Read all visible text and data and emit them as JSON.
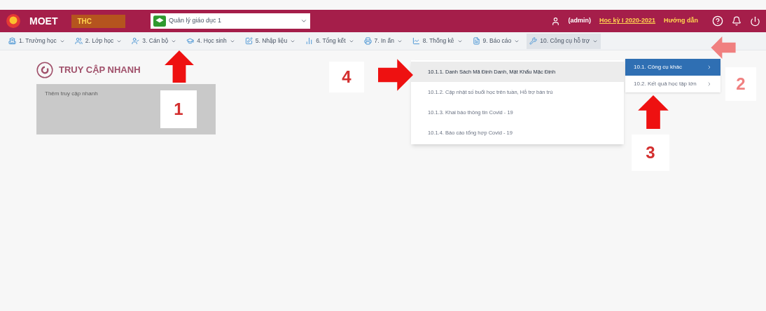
{
  "header": {
    "logo": "MOET",
    "school": "THC",
    "unit_select": "Quản lý giáo dục 1",
    "user": "(admin)",
    "term": "Học kỳ I 2020-2021",
    "help": "Hướng dẫn"
  },
  "nav": [
    {
      "label": "1. Trường học",
      "selected": false
    },
    {
      "label": "2. Lớp học",
      "selected": false
    },
    {
      "label": "3. Cán bộ",
      "selected": false
    },
    {
      "label": "4. Học sinh",
      "selected": false
    },
    {
      "label": "5. Nhập liệu",
      "selected": false
    },
    {
      "label": "6. Tổng kết",
      "selected": false
    },
    {
      "label": "7. In ấn",
      "selected": false
    },
    {
      "label": "8. Thống kê",
      "selected": false
    },
    {
      "label": "9. Báo cáo",
      "selected": false
    },
    {
      "label": "10. Công cụ hỗ trợ",
      "selected": true
    }
  ],
  "submenu": [
    {
      "label": "10.1. Công cụ khác",
      "selected": true
    },
    {
      "label": "10.2. Kết quả học tập lớn",
      "selected": false
    }
  ],
  "dropdown": [
    {
      "label": "10.1.1. Danh Sách Mã Định Danh, Mật Khẩu Mặc Định",
      "selected": true
    },
    {
      "label": "10.1.2. Cập nhật số buổi học trên tuần, Hỗ trợ bán trú",
      "selected": false
    },
    {
      "label": "10.1.3. Khai báo thông tin Covid - 19",
      "selected": false
    },
    {
      "label": "10.1.4. Báo cáo tổng hợp Covid - 19",
      "selected": false
    }
  ],
  "quick_access": {
    "title": "TRUY CẬP NHANH",
    "card": "Thêm truy cập nhanh"
  },
  "annotations": [
    "1",
    "2",
    "3",
    "4"
  ]
}
